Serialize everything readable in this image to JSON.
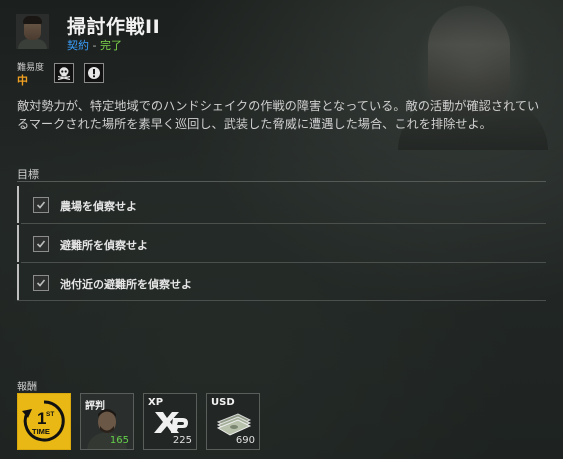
{
  "header": {
    "title": "掃討作戦II",
    "contract_label": "契約",
    "separator": " - ",
    "status": "完了"
  },
  "difficulty": {
    "label": "難易度",
    "value": "中",
    "modifiers": [
      "skull-icon",
      "alert-icon"
    ]
  },
  "description": "敵対勢力が、特定地域でのハンドシェイクの作戦の障害となっている。敵の活動が確認されているマークされた場所を素早く巡回し、武装した脅威に遭遇した場合、これを排除せよ。",
  "objectives": {
    "label": "目標",
    "items": [
      {
        "text": "農場を偵察せよ",
        "checked": true
      },
      {
        "text": "避難所を偵察せよ",
        "checked": true
      },
      {
        "text": "池付近の避難所を偵察せよ",
        "checked": true
      }
    ]
  },
  "rewards": {
    "label": "報酬",
    "items": [
      {
        "icon": "first-time-icon",
        "top": "1",
        "sup": "ST",
        "bottom": "TIME"
      },
      {
        "tag": "評判",
        "value": "165",
        "icon": "faction-portrait"
      },
      {
        "tag": "XP",
        "value": "225",
        "icon": "xp-icon"
      },
      {
        "tag": "USD",
        "value": "690",
        "icon": "cash-icon"
      }
    ]
  },
  "colors": {
    "accent_blue": "#3aa0ff",
    "complete_green": "#7fd84c",
    "difficulty_orange": "#f0a020",
    "reward_gold": "#e9b814"
  }
}
